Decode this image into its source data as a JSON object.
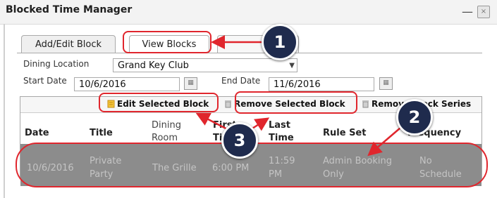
{
  "window": {
    "title": "Blocked Time Manager",
    "minimize_glyph": "—",
    "close_glyph": "×"
  },
  "tabs": [
    {
      "label": "Add/Edit Block"
    },
    {
      "label": "View Blocks"
    }
  ],
  "filters": {
    "dining_location_label": "Dining Location",
    "dining_location_value": "Grand Key Club",
    "start_date_label": "Start Date",
    "start_date_value": "10/6/2016",
    "end_date_label": "End Date",
    "end_date_value": "11/6/2016"
  },
  "toolbar": {
    "edit_label": "Edit Selected Block",
    "remove_label": "Remove Selected Block",
    "remove_series_label": "Remove Block Series"
  },
  "table": {
    "columns": [
      "Date",
      "Title",
      "Dining Room",
      "First Time",
      "Last Time",
      "Rule Set",
      "Frequency"
    ],
    "rows": [
      {
        "date": "10/6/2016",
        "title": "Private Party",
        "dining_room": "The Grille",
        "first_time": "6:00 PM",
        "last_time": "11:59 PM",
        "rule_set": "Admin Booking Only",
        "frequency": "No Schedule"
      }
    ]
  },
  "callouts": [
    "1",
    "2",
    "3"
  ],
  "colors": {
    "highlight": "#e0262d",
    "badge": "#1f2b4d",
    "selected_row": "#8c8c8c"
  },
  "icons": [
    "edit-icon",
    "trash-icon",
    "calendar-icon",
    "dropdown-arrow-icon"
  ]
}
